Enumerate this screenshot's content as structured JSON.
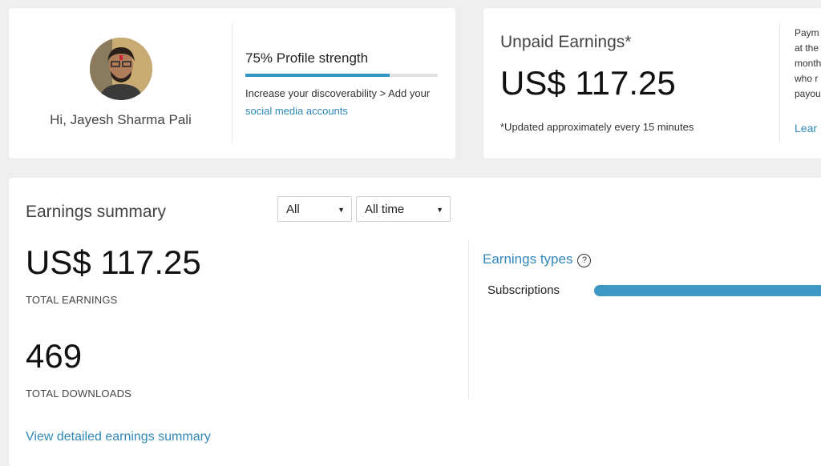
{
  "profile": {
    "greeting": "Hi, Jayesh Sharma Pali",
    "strength_label": "75% Profile strength",
    "strength_percent": 75,
    "tip_text": "Increase your discoverability > Add your",
    "tip_link": "social media accounts"
  },
  "unpaid": {
    "title": "Unpaid Earnings*",
    "amount": "US$ 117.25",
    "note": "*Updated approximately every 15 minutes",
    "side_lines": [
      "Paym",
      "at the",
      "month",
      "who r",
      "payou"
    ],
    "learn_link": "Lear"
  },
  "summary": {
    "title": "Earnings summary",
    "filter_type": "All",
    "filter_time": "All time",
    "total_earnings": "US$ 117.25",
    "total_earnings_label": "TOTAL EARNINGS",
    "total_downloads": "469",
    "total_downloads_label": "TOTAL DOWNLOADS",
    "detail_link": "View detailed earnings summary",
    "types_title": "Earnings types",
    "types": [
      {
        "label": "Subscriptions"
      }
    ]
  },
  "colors": {
    "accent": "#2f87b8",
    "bar": "#3d97c3"
  },
  "icons": {
    "help": "question-circle-icon",
    "caret": "caret-down-icon"
  }
}
